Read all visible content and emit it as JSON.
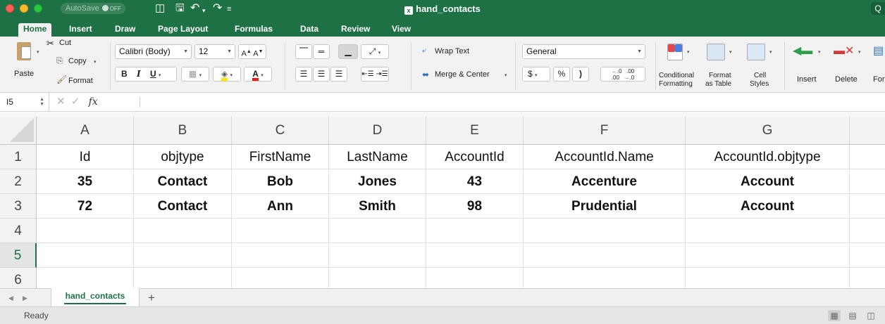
{
  "window": {
    "title": "hand_contacts",
    "autosave_label": "AutoSave",
    "autosave_state": "OFF"
  },
  "menu_tabs": [
    "Home",
    "Insert",
    "Draw",
    "Page Layout",
    "Formulas",
    "Data",
    "Review",
    "View"
  ],
  "ribbon": {
    "paste": "Paste",
    "cut": "Cut",
    "copy": "Copy",
    "format": "Format",
    "font_name": "Calibri (Body)",
    "font_size": "12",
    "bold": "B",
    "italic": "I",
    "underline": "U",
    "wrap_text": "Wrap Text",
    "merge_center": "Merge & Center",
    "number_format": "General",
    "currency": "$",
    "percent": "%",
    "comma": ")",
    "conditional_1": "Conditional",
    "conditional_2": "Formatting",
    "format_table_1": "Format",
    "format_table_2": "as Table",
    "cell_styles_1": "Cell",
    "cell_styles_2": "Styles",
    "insert": "Insert",
    "delete": "Delete",
    "format_cut": "For"
  },
  "formula_bar": {
    "name_box": "I5",
    "fx": "fx",
    "content": ""
  },
  "sheet": {
    "columns": [
      "A",
      "B",
      "C",
      "D",
      "E",
      "F",
      "G"
    ],
    "row_numbers": [
      "1",
      "2",
      "3",
      "4",
      "5",
      "6"
    ],
    "selected_row": "5",
    "rows": [
      [
        "Id",
        "objtype",
        "FirstName",
        "LastName",
        "AccountId",
        "AccountId.Name",
        "AccountId.objtype"
      ],
      [
        "35",
        "Contact",
        "Bob",
        "Jones",
        "43",
        "Accenture",
        "Account"
      ],
      [
        "72",
        "Contact",
        "Ann",
        "Smith",
        "98",
        "Prudential",
        "Account"
      ],
      [
        "",
        "",
        "",
        "",
        "",
        "",
        ""
      ],
      [
        "",
        "",
        "",
        "",
        "",
        "",
        ""
      ],
      [
        "",
        "",
        "",
        "",
        "",
        "",
        ""
      ]
    ]
  },
  "sheet_tabs": {
    "active": "hand_contacts",
    "add": "+"
  },
  "status": {
    "text": "Ready"
  },
  "colors": {
    "accent": "#1e7145",
    "ribbon_bg": "#f2f2f2"
  }
}
